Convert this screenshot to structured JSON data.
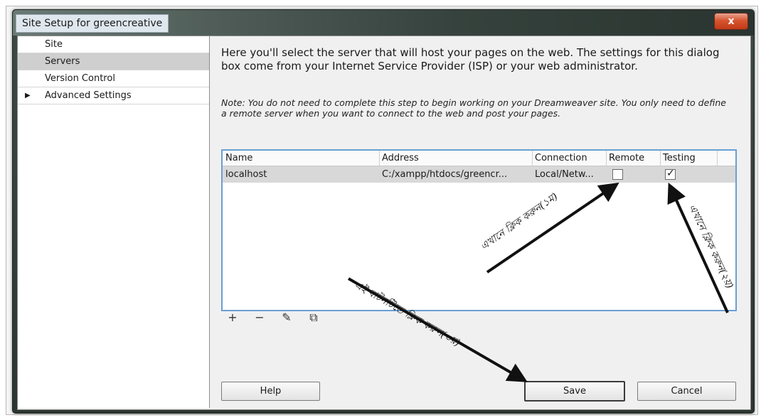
{
  "window": {
    "title": "Site Setup for greencreative",
    "close_label": "x"
  },
  "sidebar": {
    "items": [
      {
        "label": "Site",
        "selected": false,
        "expandable": false
      },
      {
        "label": "Servers",
        "selected": true,
        "expandable": false
      },
      {
        "label": "Version Control",
        "selected": false,
        "expandable": false
      },
      {
        "label": "Advanced Settings",
        "selected": false,
        "expandable": true,
        "arrow": "▶"
      }
    ]
  },
  "main": {
    "intro": "Here you'll select the server that will host your pages on the web. The settings for this dialog box come from your Internet Service Provider (ISP) or your web administrator.",
    "note": "Note: You do not need to complete this step to begin working on your Dreamweaver site. You only need to define a remote server when you want to connect to the web and post your pages."
  },
  "table": {
    "columns": [
      "Name",
      "Address",
      "Connection",
      "Remote",
      "Testing"
    ],
    "rows": [
      {
        "name": "localhost",
        "address": "C:/xampp/htdocs/greencr...",
        "connection": "Local/Netw...",
        "remote": false,
        "testing": true
      }
    ]
  },
  "toolbar": {
    "icons": [
      "plus-icon",
      "minus-icon",
      "pencil-icon",
      "duplicate-icon"
    ],
    "glyphs": {
      "add": "+",
      "remove": "−",
      "edit": "✎",
      "duplicate": "⧉"
    }
  },
  "buttons": {
    "help": "Help",
    "save": "Save",
    "cancel": "Cancel"
  },
  "annotations": {
    "step1": "এখানে ক্লিক করুন(১ম)",
    "step2": "এখানে ক্লিক করুন(২য়)",
    "step3": "এই বাটনটিতে ক্লিক করুন(৩য়)"
  },
  "check_glyph": "✓",
  "colors": {
    "selection": "#cfcfcf",
    "table_border": "#6b9fd3",
    "close_button": "#c23a17"
  }
}
